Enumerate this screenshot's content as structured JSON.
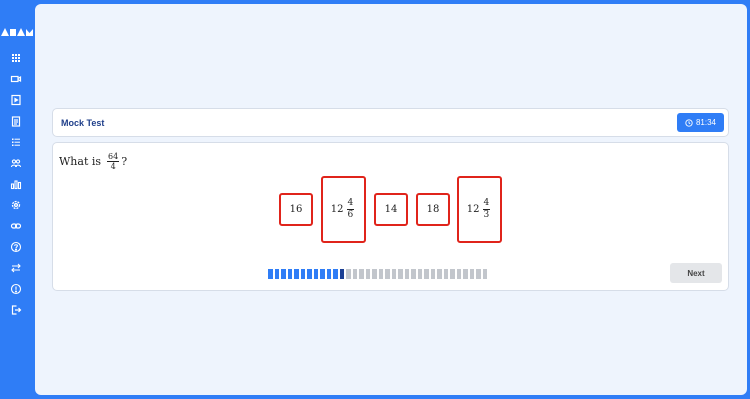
{
  "sidebar": {
    "icons": [
      "grid-icon",
      "video-icon",
      "play-box-icon",
      "clipboard-icon",
      "list-icon",
      "users-icon",
      "bar-chart-icon",
      "settings-icon",
      "link-icon",
      "help-icon",
      "swap-icon",
      "info-icon",
      "logout-icon"
    ]
  },
  "header": {
    "title": "Mock Test",
    "timer": "81:34"
  },
  "question": {
    "prefix": "What is",
    "numerator": "64",
    "denominator": "4",
    "suffix": "?"
  },
  "options": [
    {
      "whole": "16"
    },
    {
      "whole": "12",
      "numerator": "4",
      "denominator": "6"
    },
    {
      "whole": "14"
    },
    {
      "whole": "18"
    },
    {
      "whole": "12",
      "numerator": "4",
      "denominator": "3"
    }
  ],
  "progress": {
    "total": 34,
    "answered": 11,
    "current": 12,
    "colors": {
      "answered": "#2f7df6",
      "current": "#1b3f94",
      "pending": "#c2c6cc"
    }
  },
  "next_label": "Next",
  "colors": {
    "accent": "#2f7df6",
    "option_border": "#e0241b",
    "page_bg": "#eef4fd"
  }
}
